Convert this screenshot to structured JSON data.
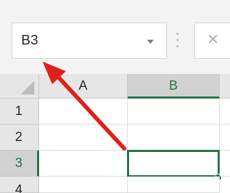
{
  "name_box": {
    "value": "B3",
    "dropdown_icon": "chevron-down-icon"
  },
  "formula_bar": {
    "cancel_symbol": "✕",
    "cancel_icon": "close-icon",
    "separator_icon": "vertical-dots-icon"
  },
  "grid": {
    "select_all_icon": "select-all-triangle-icon",
    "columns": [
      "A",
      "B"
    ],
    "rows": [
      "1",
      "2",
      "3",
      "4"
    ],
    "active_cell": "B3",
    "accent_color": "#217346"
  },
  "annotation": {
    "icon": "red-arrow-icon",
    "color": "#e0201b"
  }
}
